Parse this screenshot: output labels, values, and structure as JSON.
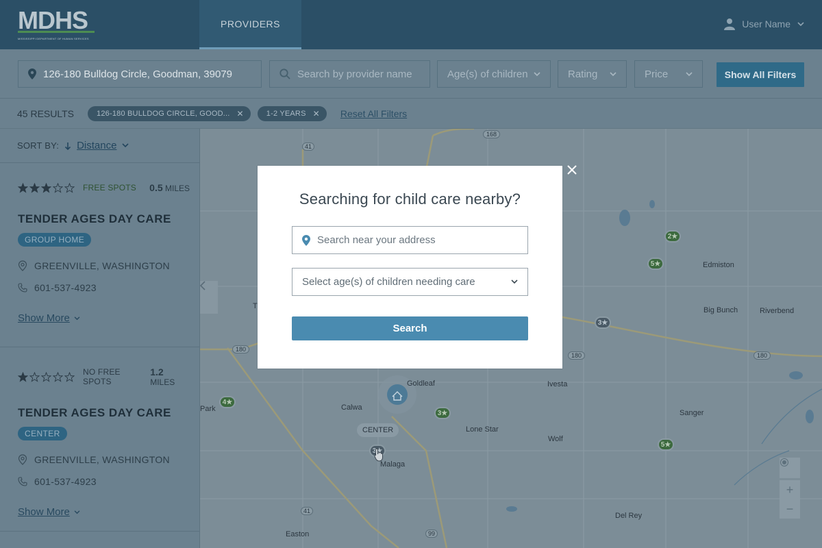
{
  "header": {
    "logo_text": "MDHS",
    "logo_subtitle": "MISSISSIPPI DEPARTMENT OF HUMAN SERVICES",
    "nav_providers": "PROVIDERS",
    "user_name": "User Name"
  },
  "filters": {
    "address_value": "126-180 Bulldog Circle, Goodman, 39079",
    "provider_name_placeholder": "Search by provider name",
    "age_label": "Age(s) of children",
    "rating_label": "Rating",
    "price_label": "Price",
    "show_all_label": "Show All Filters"
  },
  "results": {
    "count_text": "45 RESULTS",
    "chips": [
      {
        "label": "126-180 BULLDOG CIRCLE, GOOD..."
      },
      {
        "label": "1-2 YEARS"
      }
    ],
    "reset_label": "Reset All Filters"
  },
  "sort": {
    "label": "SORT BY:",
    "value": "Distance"
  },
  "providers": [
    {
      "rating": 3,
      "rating_max": 5,
      "spots": "FREE SPOTS",
      "distance": "0.5",
      "distance_unit": "MILES",
      "name": "TENDER AGES DAY CARE",
      "type": "GROUP HOME",
      "location": "GREENVILLE, WASHINGTON",
      "phone": "601-537-4923",
      "show_more": "Show More"
    },
    {
      "rating": 1,
      "rating_max": 5,
      "spots": "NO FREE SPOTS",
      "distance": "1.2",
      "distance_unit": "MILES",
      "name": "TENDER AGES DAY CARE",
      "type": "CENTER",
      "location": "GREENVILLE, WASHINGTON",
      "phone": "601-537-4923",
      "show_more": "Show More"
    }
  ],
  "map": {
    "places": [
      "Goldleaf",
      "Calwa",
      "Malaga",
      "Lone Star",
      "Wolf",
      "Ivesta",
      "Sanger",
      "Edmiston",
      "Big Bunch",
      "Riverbend",
      "Del Rey",
      "Easton",
      "Park",
      "Th"
    ],
    "route_labels": [
      "41",
      "168",
      "180",
      "180",
      "180",
      "41",
      "99"
    ],
    "clusters": [
      "2★",
      "5★",
      "3★",
      "4★",
      "3★",
      "5★",
      "3★"
    ],
    "center_label": "CENTER",
    "zoom_in": "+",
    "zoom_out": "−"
  },
  "modal": {
    "title": "Searching for child care nearby?",
    "address_placeholder": "Search near your address",
    "age_placeholder": "Select age(s) of children needing care",
    "search_label": "Search",
    "close_label": "×"
  },
  "colors": {
    "header_bg": "#2b4f66",
    "accent": "#4a8bb0",
    "tag_bg": "#2e6482",
    "star": "#2b3a45"
  }
}
